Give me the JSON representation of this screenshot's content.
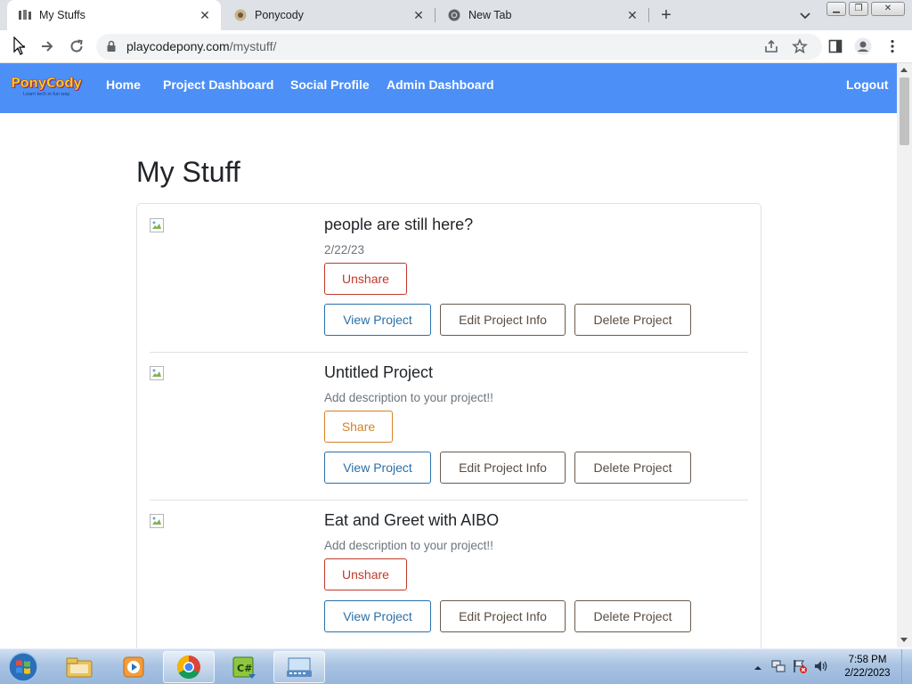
{
  "browser": {
    "tabs": [
      {
        "title": "My Stuffs",
        "active": true
      },
      {
        "title": "Ponycody",
        "active": false
      },
      {
        "title": "New Tab",
        "active": false
      }
    ],
    "url_host": "playcodepony.com",
    "url_path": "/mystuff/"
  },
  "navbar": {
    "logo_text": "PonyCody",
    "logo_tagline": "Learn tech in fun way",
    "links": [
      "Home",
      "Project Dashboard",
      "Social Profile",
      "Admin Dashboard"
    ],
    "logout": "Logout",
    "background": "#4c8ff7"
  },
  "page": {
    "title": "My Stuff",
    "projects": [
      {
        "title": "people are still here?",
        "description": "2/22/23",
        "share_label": "Unshare",
        "shared": true,
        "view_label": "View Project",
        "edit_label": "Edit Project Info",
        "delete_label": "Delete Project"
      },
      {
        "title": "Untitled Project",
        "description": "Add description to your project!!",
        "share_label": "Share",
        "shared": false,
        "view_label": "View Project",
        "edit_label": "Edit Project Info",
        "delete_label": "Delete Project"
      },
      {
        "title": "Eat and Greet with AIBO",
        "description": "Add description to your project!!",
        "share_label": "Unshare",
        "shared": true,
        "view_label": "View Project",
        "edit_label": "Edit Project Info",
        "delete_label": "Delete Project"
      }
    ]
  },
  "taskbar": {
    "apps": [
      "explorer-icon",
      "media-player-icon",
      "chrome-icon",
      "csharp-icon",
      "keyboard-app-icon"
    ],
    "time": "7:58 PM",
    "date": "2/22/2023"
  }
}
